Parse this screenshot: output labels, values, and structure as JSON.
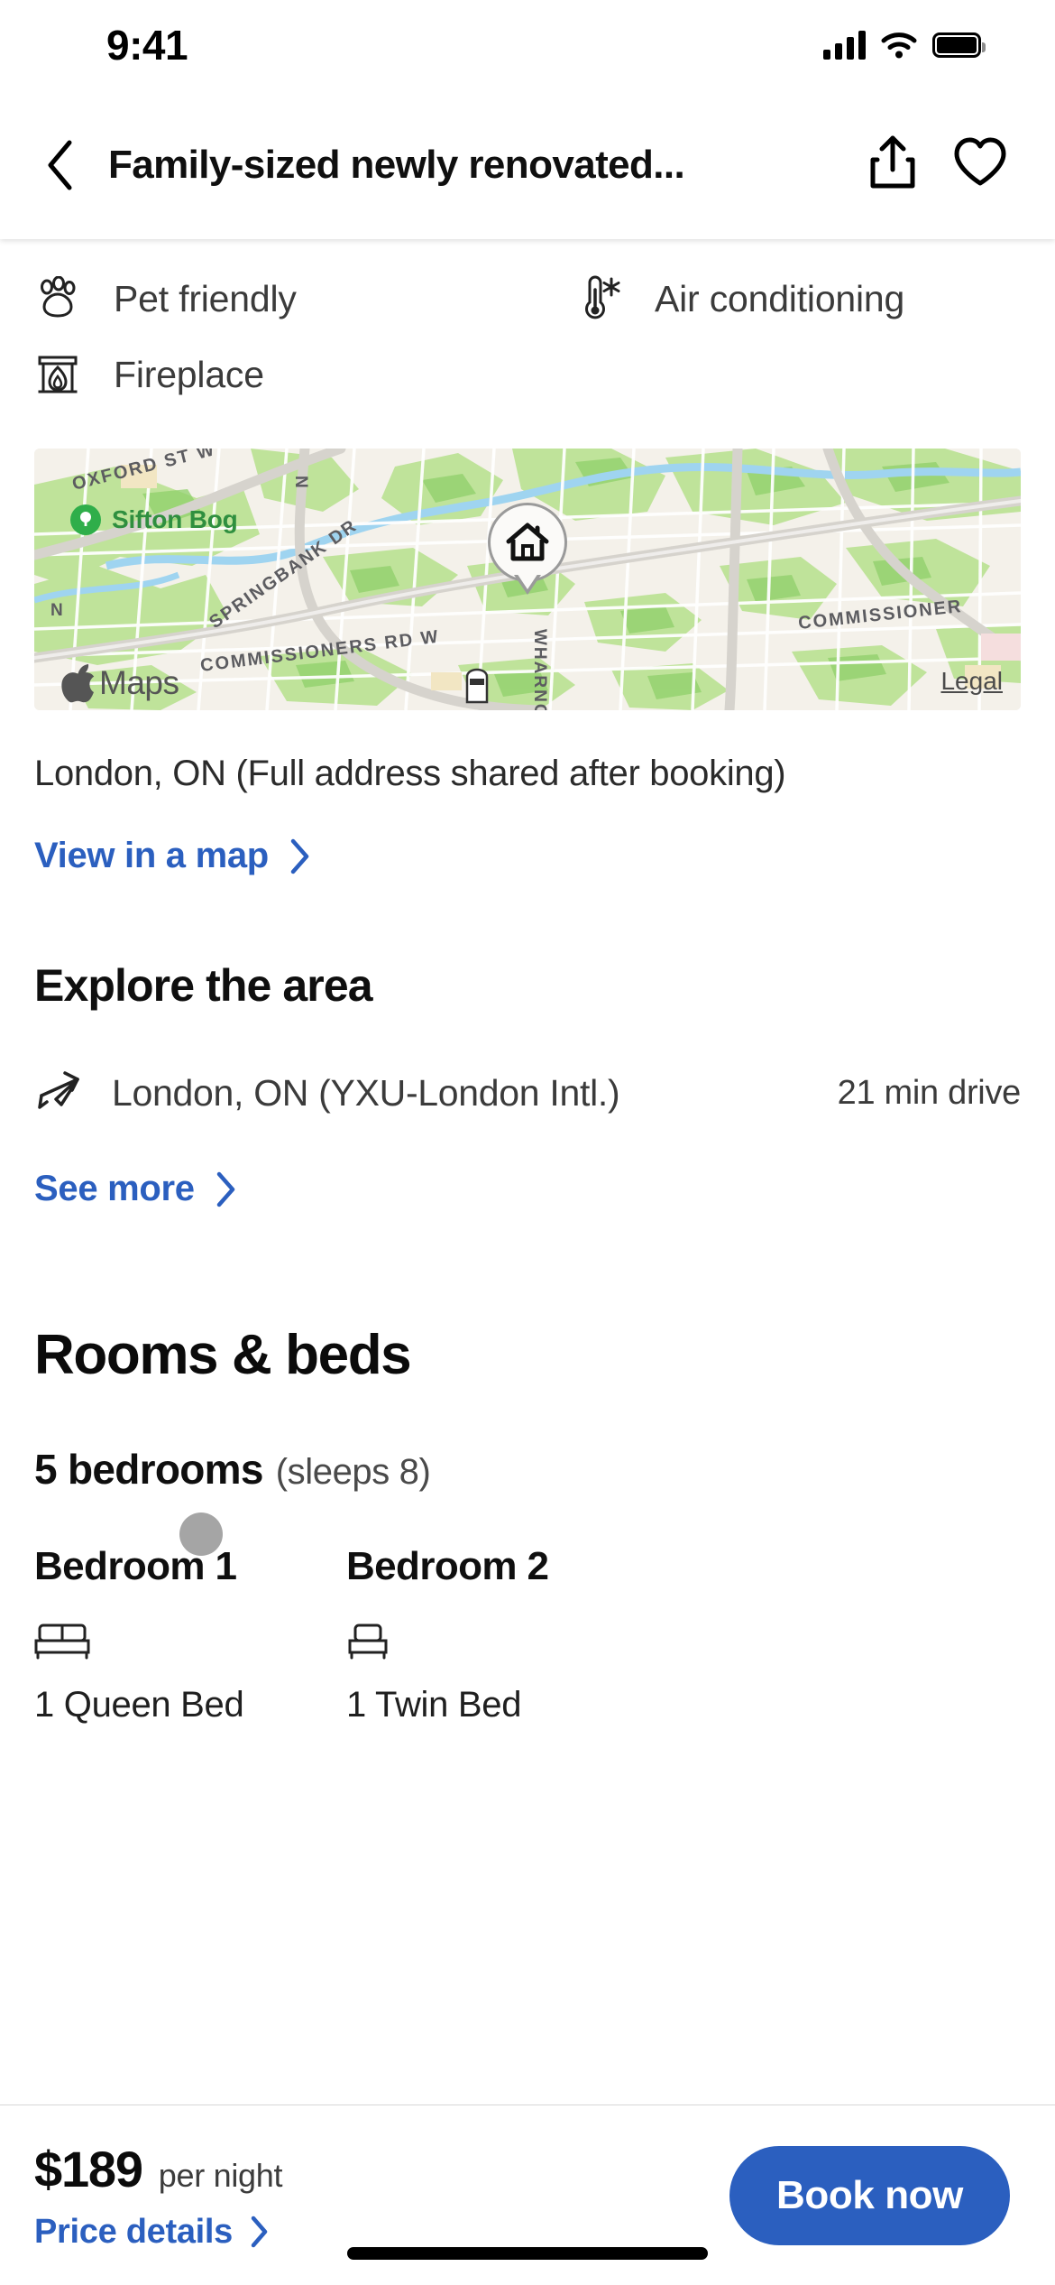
{
  "status_bar": {
    "time": "9:41",
    "cellular_icon": "cellular-signal-icon",
    "wifi_icon": "wifi-icon",
    "battery_icon": "battery-full-icon"
  },
  "nav": {
    "back_icon": "chevron-left-icon",
    "title": "Family-sized newly renovated...",
    "share_icon": "share-icon",
    "favorite_icon": "heart-outline-icon"
  },
  "amenities": [
    {
      "icon": "paw-print-icon",
      "label": "Pet friendly"
    },
    {
      "icon": "thermometer-snowflake-icon",
      "label": "Air conditioning"
    },
    {
      "icon": "fireplace-icon",
      "label": "Fireplace"
    }
  ],
  "map": {
    "provider_label": "Maps",
    "provider_icon": "apple-logo-icon",
    "legal_label": "Legal",
    "property_pin_icon": "house-pin-icon",
    "poi": {
      "name": "Sifton Bog",
      "icon": "park-tree-icon"
    },
    "street_labels": [
      "OXFORD ST W",
      "SPRINGBANK DR",
      "COMMISSIONERS RD W",
      "COMMISSIONER",
      "WHARNCLIFFE RD S",
      "N"
    ]
  },
  "location": {
    "address_text": "London, ON (Full address shared after booking)",
    "view_map_label": "View in a map",
    "chevron_icon": "chevron-right-icon"
  },
  "explore": {
    "heading": "Explore the area",
    "items": [
      {
        "icon": "airplane-icon",
        "name": "London, ON (YXU-London Intl.)",
        "distance": "21 min drive"
      }
    ],
    "see_more_label": "See more",
    "chevron_icon": "chevron-right-icon"
  },
  "rooms": {
    "heading": "Rooms & beds",
    "bedroom_count": "5 bedrooms",
    "sleeps": "(sleeps 8)",
    "bedrooms": [
      {
        "title": "Bedroom 1",
        "icon": "double-bed-icon",
        "beds": "1 Queen Bed"
      },
      {
        "title": "Bedroom 2",
        "icon": "single-bed-icon",
        "beds": "1 Twin Bed"
      }
    ]
  },
  "booking_bar": {
    "price": "$189",
    "price_unit": "per night",
    "price_details_label": "Price details",
    "chevron_icon": "chevron-right-icon",
    "book_button_label": "Book now",
    "accent_color": "#2b5fbf"
  }
}
